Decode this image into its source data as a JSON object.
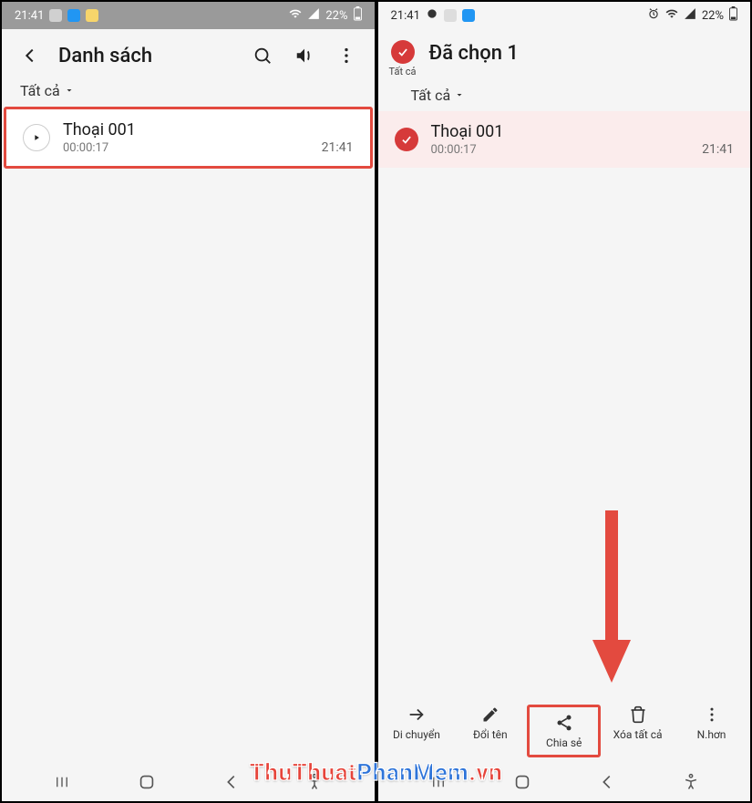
{
  "statusbar_left": {
    "time": "21:41",
    "battery": "22%"
  },
  "statusbar_right": {
    "time": "21:41",
    "battery": "22%"
  },
  "left_screen": {
    "header_title": "Danh sách",
    "filter_label": "Tất cả",
    "item": {
      "name": "Thoại 001",
      "duration": "00:00:17",
      "time": "21:41"
    }
  },
  "right_screen": {
    "select_all_label": "Tất cả",
    "header_title": "Đã chọn 1",
    "filter_label": "Tất cả",
    "item": {
      "name": "Thoại 001",
      "duration": "00:00:17",
      "time": "21:41"
    },
    "actions": {
      "move": "Di chuyển",
      "rename": "Đổi tên",
      "share": "Chia sẻ",
      "delete_all": "Xóa tất cả",
      "more": "N.hơn"
    }
  },
  "watermark": {
    "a": "ThuThuat",
    "b": "PhanMem",
    "c": ".vn"
  }
}
